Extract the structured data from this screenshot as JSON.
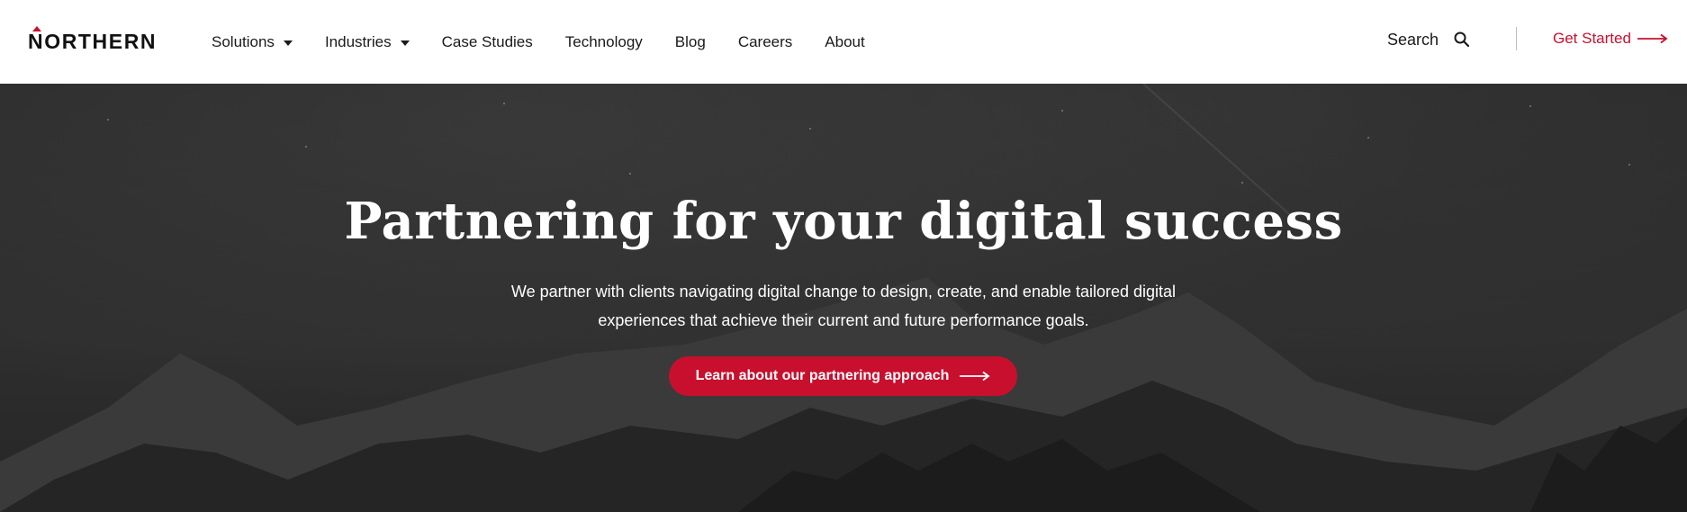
{
  "brand": {
    "name": "NORTHERN",
    "accent": "#c8102e"
  },
  "nav": {
    "items": [
      {
        "label": "Solutions",
        "dropdown": true
      },
      {
        "label": "Industries",
        "dropdown": true
      },
      {
        "label": "Case Studies",
        "dropdown": false
      },
      {
        "label": "Technology",
        "dropdown": false
      },
      {
        "label": "Blog",
        "dropdown": false
      },
      {
        "label": "Careers",
        "dropdown": false
      },
      {
        "label": "About",
        "dropdown": false
      }
    ]
  },
  "search": {
    "label": "Search",
    "icon": "search-icon"
  },
  "header_cta": {
    "label": "Get Started",
    "icon": "arrow-right-icon"
  },
  "hero": {
    "title": "Partnering for your digital success",
    "subtitle_line1": "We partner with clients navigating digital change to design, create, and enable tailored digital",
    "subtitle_line2": "experiences that achieve their current and future performance goals.",
    "cta_label": "Learn about our partnering approach",
    "cta_icon": "arrow-right-icon",
    "background": "dark mountain landscape"
  }
}
